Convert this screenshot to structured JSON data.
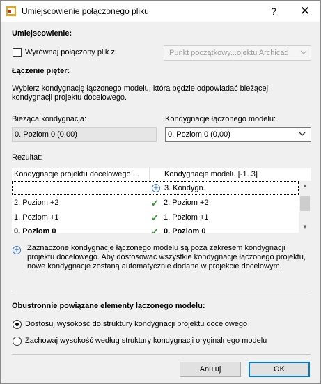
{
  "window": {
    "title": "Umiejscowienie połączonego pliku",
    "help_label": "?",
    "close_label": "✕"
  },
  "placement": {
    "heading": "Umiejscowienie:",
    "align_label": "Wyrównaj połączony plik z:",
    "align_dropdown": "Punkt początkowy...ojektu Archicad"
  },
  "floors": {
    "heading": "Łączenie pięter:",
    "description": "Wybierz kondygnację łączonego modelu, która będzie odpowiadać bieżącej kondygnacji projektu docelowego.",
    "current_label": "Bieżąca kondygnacja:",
    "current_value": "0. Poziom 0 (0,00)",
    "linked_label": "Kondygnacje łączonego modelu:",
    "linked_value": "0. Poziom 0 (0,00)"
  },
  "result": {
    "heading": "Rezultat:",
    "columns": [
      "Kondygnacje projektu docelowego ...",
      "Kondygnacje modelu [-1..3]"
    ],
    "rows": [
      {
        "target": "",
        "icon": "add-circle-icon",
        "model": "3. Kondygn.",
        "bold": false
      },
      {
        "target": "2. Poziom +2",
        "icon": "check-icon",
        "model": "2. Poziom +2",
        "bold": false
      },
      {
        "target": "1. Poziom +1",
        "icon": "check-icon",
        "model": "1. Poziom +1",
        "bold": false
      },
      {
        "target": "0. Poziom 0",
        "icon": "check-icon",
        "model": "0. Poziom 0",
        "bold": true
      }
    ]
  },
  "info": {
    "text": "Zaznaczone kondygnacje łączonego modelu są poza zakresem kondygnacji projektu docelowego. Aby dostosować wszystkie kondygnacje łączonego projektu, nowe kondygnacje zostaną automatycznie dodane w projekcie docelowym."
  },
  "associated": {
    "heading": "Obustronnie powiązane elementy łączonego modelu:",
    "option1": "Dostosuj wysokość do struktury kondygnacji projektu docelowego",
    "option2": "Zachowaj wysokość według struktury kondygnacji oryginalnego modelu",
    "selected": 1
  },
  "buttons": {
    "cancel": "Anuluj",
    "ok": "OK"
  },
  "colors": {
    "accent": "#0078d7",
    "check": "#2d9a2d",
    "info": "#3a7bd5"
  }
}
